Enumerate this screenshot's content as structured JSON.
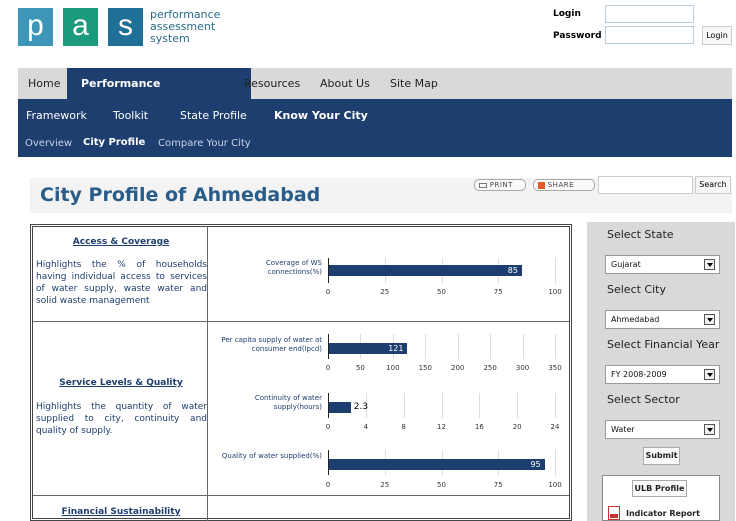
{
  "logo": {
    "letters": [
      "p",
      "a",
      "s"
    ],
    "colors": [
      "#3d95b8",
      "#1c9a7c",
      "#1f6f96"
    ],
    "text": [
      "performance",
      "assessment",
      "system"
    ]
  },
  "login": {
    "login_label": "Login",
    "password_label": "Password",
    "button": "Login"
  },
  "nav": {
    "primary": [
      "Home",
      "Performance Assessment",
      "Resources",
      "About Us",
      "Site Map"
    ],
    "active_primary": "Performance Assessment",
    "secondary": [
      "Framework",
      "Toolkit",
      "State Profile",
      "Know Your City"
    ],
    "tertiary": [
      "Overview",
      "City Profile",
      "Compare Your City"
    ]
  },
  "page": {
    "title": "City Profile of Ahmedabad",
    "print": "PRINT",
    "share": "SHARE",
    "search_button": "Search"
  },
  "sections": [
    {
      "heading": "Access & Coverage",
      "description": "Highlights the % of households having individual access to services of water supply, waste water and solid waste management"
    },
    {
      "heading": "Service Levels & Quality",
      "description": "Highlights the quantity of water supplied to city, continuity and quality of supply."
    },
    {
      "heading": "Financial Sustainability"
    }
  ],
  "chart_data": [
    {
      "type": "bar",
      "categories": [
        "Coverage of WS connections(%)"
      ],
      "values": [
        85
      ],
      "xlim": [
        0,
        100
      ],
      "ticks": [
        0,
        25,
        50,
        75,
        100
      ]
    },
    {
      "type": "bar",
      "categories": [
        "Per capita supply of water at consumer end(lpcd)"
      ],
      "values": [
        121
      ],
      "xlim": [
        0,
        350
      ],
      "ticks": [
        0,
        50,
        100,
        150,
        200,
        250,
        300,
        350
      ]
    },
    {
      "type": "bar",
      "categories": [
        "Continuity of water supply(hours)"
      ],
      "values": [
        2.3
      ],
      "xlim": [
        0,
        24
      ],
      "ticks": [
        0,
        4,
        8,
        12,
        16,
        20,
        24
      ]
    },
    {
      "type": "bar",
      "categories": [
        "Quality of water supplied(%)"
      ],
      "values": [
        95
      ],
      "xlim": [
        0,
        100
      ],
      "ticks": [
        0,
        25,
        50,
        75,
        100
      ]
    }
  ],
  "sidebar": {
    "state_label": "Select State",
    "state_value": "Gujarat",
    "city_label": "Select City",
    "city_value": "Ahmedabad",
    "year_label": "Select Financial Year",
    "year_value": "FY 2008-2009",
    "sector_label": "Select Sector",
    "sector_value": "Water",
    "submit": "Submit",
    "ulb_button": "ULB Profile",
    "indicator_link": "Indicator Report"
  }
}
